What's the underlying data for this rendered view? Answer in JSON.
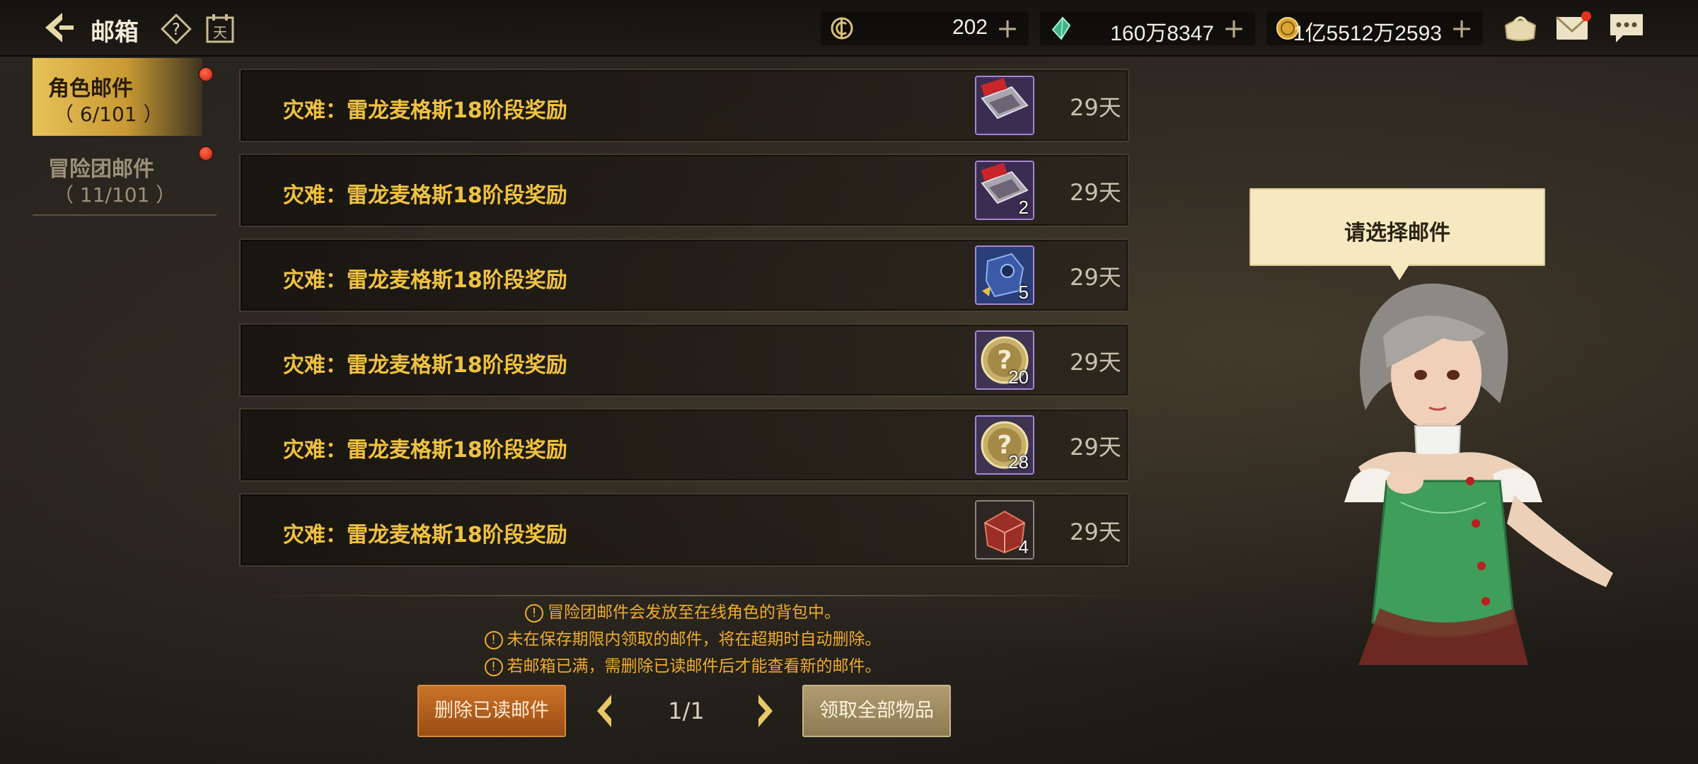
{
  "header": {
    "title": "邮箱",
    "resources": [
      {
        "icon": "coin-c-icon",
        "value": "202"
      },
      {
        "icon": "crystal-icon",
        "value": "160万8347"
      },
      {
        "icon": "gold-coin-icon",
        "value": "1亿5512万2593"
      }
    ],
    "plus": "+",
    "help_glyph": "?",
    "calendar_glyph": "天"
  },
  "sidebar": {
    "tabs": [
      {
        "label": "角色邮件",
        "count": "（ 6/101 ）",
        "active": true
      },
      {
        "label": "冒险团邮件",
        "count": "（ 11/101 ）",
        "active": false
      }
    ]
  },
  "mails": [
    {
      "title": "灾难：雷龙麦格斯18阶段奖励",
      "item": "contract-scroll-icon",
      "count": "",
      "days": "29天"
    },
    {
      "title": "灾难：雷龙麦格斯18阶段奖励",
      "item": "contract-scroll-icon",
      "count": "2",
      "days": "29天"
    },
    {
      "title": "灾难：雷龙麦格斯18阶段奖励",
      "item": "equipment-box-icon",
      "count": "5",
      "days": "29天"
    },
    {
      "title": "灾难：雷龙麦格斯18阶段奖励",
      "item": "mystery-coin-icon",
      "count": "20",
      "days": "29天"
    },
    {
      "title": "灾难：雷龙麦格斯18阶段奖励",
      "item": "mystery-coin-icon",
      "count": "28",
      "days": "29天"
    },
    {
      "title": "灾难：雷龙麦格斯18阶段奖励",
      "item": "red-gem-box-icon",
      "count": "4",
      "days": "29天"
    }
  ],
  "notices": [
    "冒险团邮件会发放至在线角色的背包中。",
    "未在保存期限内领取的邮件，将在超期时自动删除。",
    "若邮箱已满，需删除已读邮件后才能查看新的邮件。"
  ],
  "notice_glyph": "!",
  "footer": {
    "delete_label": "删除已读邮件",
    "page": "1/1",
    "collect_label": "领取全部物品"
  },
  "bubble": {
    "text": "请选择邮件"
  },
  "colors": {
    "accent_gold": "#f0c240",
    "notice_orange": "#efac2e",
    "delete_btn": "#b35f1e",
    "collect_btn": "#9f8b61"
  }
}
